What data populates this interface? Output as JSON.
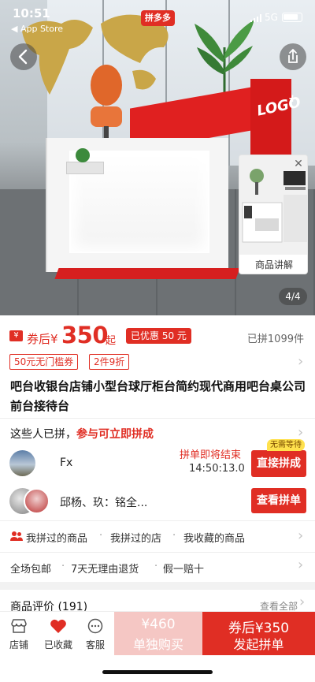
{
  "status_bar": {
    "time": "10:51",
    "back_app": "◀ App Store",
    "network": "5G",
    "app_badge": "拼多多"
  },
  "hero": {
    "logo_text": "LOGO",
    "thumbnail_label": "商品讲解",
    "pager": "4/4"
  },
  "price": {
    "coupon_glyph": "¥",
    "prefix": "券后¥",
    "value": "350",
    "suffix": "起",
    "discount_tag": "已优惠 50 元",
    "sold": "已拼1099件"
  },
  "tags": [
    "50元无门槛券",
    "2件9折"
  ],
  "title": "吧台收银台店铺小型台球厅柜台简约现代商用吧台桌公司前台接待台",
  "group": {
    "header_prefix": "这些人已拼，",
    "header_highlight": "参与可立即拼成",
    "rows": [
      {
        "name": "Fx",
        "status": "拼单即将结束",
        "timer": "14:50:13.0",
        "badge": "无需等待",
        "button": "直接拼成"
      },
      {
        "name": "邱杨、玖：铭全...",
        "button": "查看拼单"
      }
    ]
  },
  "history": [
    "我拼过的商品",
    "我拼过的店",
    "我收藏的商品"
  ],
  "services": [
    "全场包邮",
    "7天无理由退货",
    "假一赔十"
  ],
  "reviews": {
    "title": "商品评价 (191)",
    "view_all": "查看全部"
  },
  "bottom_bar": {
    "store": "店铺",
    "favorited": "已收藏",
    "service": "客服",
    "solo_price": "¥460",
    "solo_label": "单独购买",
    "group_price": "券后¥350",
    "group_label": "发起拼单"
  },
  "colors": {
    "brand_red": "#e02e24",
    "solo_pink": "#f5c7c4"
  }
}
